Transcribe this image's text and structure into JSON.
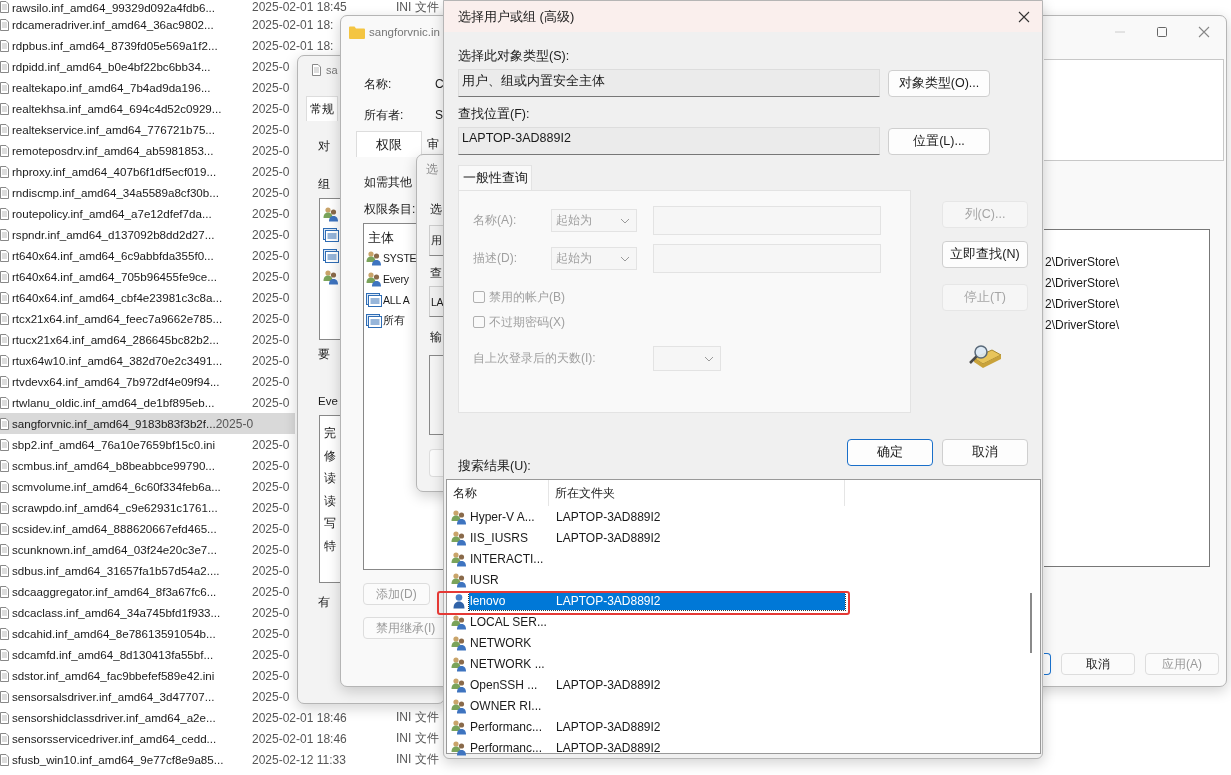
{
  "file_list": {
    "rows": [
      {
        "name": "rawsilo.inf_amd64_99329d092a4fdb6...",
        "date": "2025-02-01 18:45",
        "type": "INI 文件",
        "selected": false
      },
      {
        "name": "rdcameradriver.inf_amd64_36ac9802...",
        "date": "2025-02-01 18:",
        "selected": false
      },
      {
        "name": "rdpbus.inf_amd64_8739fd05e569a1f2...",
        "date": "2025-02-01 18:",
        "selected": false
      },
      {
        "name": "rdpidd.inf_amd64_b0e4bf22bc6bb34...",
        "date": "2025-0",
        "selected": false
      },
      {
        "name": "realtekapo.inf_amd64_7b4ad9da196...",
        "date": "2025-0",
        "selected": false
      },
      {
        "name": "realtekhsa.inf_amd64_694c4d52c0929...",
        "date": "2025-0",
        "selected": false
      },
      {
        "name": "realtekservice.inf_amd64_776721b75...",
        "date": "2025-0",
        "selected": false
      },
      {
        "name": "remoteposdrv.inf_amd64_ab5981853...",
        "date": "2025-0",
        "selected": false
      },
      {
        "name": "rhproxy.inf_amd64_407b6f1df5ecf019...",
        "date": "2025-0",
        "selected": false
      },
      {
        "name": "rndiscmp.inf_amd64_34a5589a8cf30b...",
        "date": "2025-0",
        "selected": false
      },
      {
        "name": "routepolicy.inf_amd64_a7e12dfef7da...",
        "date": "2025-0",
        "selected": false
      },
      {
        "name": "rspndr.inf_amd64_d137092b8dd2d27...",
        "date": "2025-0",
        "selected": false
      },
      {
        "name": "rt640x64.inf_amd64_6c9abbfda355f0...",
        "date": "2025-0",
        "selected": false
      },
      {
        "name": "rt640x64.inf_amd64_705b96455fe9ce...",
        "date": "2025-0",
        "selected": false
      },
      {
        "name": "rt640x64.inf_amd64_cbf4e23981c3c8a...",
        "date": "2025-0",
        "selected": false
      },
      {
        "name": "rtcx21x64.inf_amd64_feec7a9662e785...",
        "date": "2025-0",
        "selected": false
      },
      {
        "name": "rtucx21x64.inf_amd64_286645bc82b2...",
        "date": "2025-0",
        "selected": false
      },
      {
        "name": "rtux64w10.inf_amd64_382d70e2c3491...",
        "date": "2025-0",
        "selected": false
      },
      {
        "name": "rtvdevx64.inf_amd64_7b972df4e09f94...",
        "date": "2025-0",
        "selected": false
      },
      {
        "name": "rtwlanu_oldic.inf_amd64_de1bf895eb...",
        "date": "2025-0",
        "selected": false
      },
      {
        "name": "sangforvnic.inf_amd64_9183b83f3b2f...",
        "date": "2025-0",
        "selected": true
      },
      {
        "name": "sbp2.inf_amd64_76a10e7659bf15c0.ini",
        "date": "2025-0",
        "selected": false
      },
      {
        "name": "scmbus.inf_amd64_b8beabbce99790...",
        "date": "2025-0",
        "selected": false
      },
      {
        "name": "scmvolume.inf_amd64_6c60f334feb6a...",
        "date": "2025-0",
        "selected": false
      },
      {
        "name": "scrawpdo.inf_amd64_c9e62931c1761...",
        "date": "2025-0",
        "selected": false
      },
      {
        "name": "scsidev.inf_amd64_888620667efd465...",
        "date": "2025-0",
        "selected": false
      },
      {
        "name": "scunknown.inf_amd64_03f24e20c3e7...",
        "date": "2025-0",
        "selected": false
      },
      {
        "name": "sdbus.inf_amd64_31657fa1b57d54a2....",
        "date": "2025-0",
        "selected": false
      },
      {
        "name": "sdcaaggregator.inf_amd64_8f3a67fc6...",
        "date": "2025-0",
        "selected": false
      },
      {
        "name": "sdcaclass.inf_amd64_34a745bfd1f933...",
        "date": "2025-0",
        "selected": false
      },
      {
        "name": "sdcahid.inf_amd64_8e78613591054b...",
        "date": "2025-0",
        "selected": false
      },
      {
        "name": "sdcamfd.inf_amd64_8d130413fa55bf...",
        "date": "2025-0",
        "selected": false
      },
      {
        "name": "sdstor.inf_amd64_fac9bbefef589e42.ini",
        "date": "2025-0",
        "selected": false
      },
      {
        "name": "sensorsalsdriver.inf_amd64_3d47707...",
        "date": "2025-0",
        "selected": false
      },
      {
        "name": "sensorshidclassdriver.inf_amd64_a2e...",
        "date": "2025-02-01 18:46",
        "type": "INI 文件",
        "selected": false
      },
      {
        "name": "sensorsservicedriver.inf_amd64_cedd...",
        "date": "2025-02-01 18:46",
        "type": "INI 文件",
        "selected": false
      },
      {
        "name": "sfusb_win10.inf_amd64_9e77cf8e9a85...",
        "date": "2025-02-12 11:33",
        "type": "INI 文件",
        "selected": false
      }
    ]
  },
  "back_properties": {
    "title": "sa",
    "tab": "常规",
    "labels": [
      "对",
      "组"
    ],
    "entries": [
      {
        "kind": "users"
      },
      {
        "kind": "package"
      },
      {
        "kind": "package"
      },
      {
        "kind": "users"
      }
    ],
    "label_3": "要",
    "label_4": "Eve",
    "permissions": [
      "完",
      "修",
      "读",
      "读",
      "写",
      "特"
    ],
    "label_5": "有"
  },
  "properties": {
    "title": "sangforvnic.in",
    "name_label": "名称:",
    "name_value": "C",
    "owner_label": "所有者:",
    "owner_value": "S",
    "tabs": [
      {
        "label": "权限",
        "selected": true
      },
      {
        "label": "审",
        "selected": false
      }
    ],
    "hint": "如需其他",
    "entries_label": "权限条目:",
    "entries_header": "主体",
    "entries": [
      {
        "kind": "users",
        "name": "SYSTE"
      },
      {
        "kind": "users",
        "name": "Every"
      },
      {
        "kind": "package",
        "name": "ALL A"
      },
      {
        "kind": "package",
        "name": "所有"
      }
    ],
    "buttons": [
      {
        "label": "添加(D)",
        "disabled": true
      },
      {
        "label": "禁用继承(I)",
        "disabled": true
      }
    ],
    "paths": [
      "2\\DriverStore\\",
      "2\\DriverStore\\",
      "2\\DriverStore\\",
      "2\\DriverStore\\"
    ],
    "bottom_buttons": [
      {
        "label": "取消",
        "disabled": false
      },
      {
        "label": "应用(A)",
        "disabled": true
      }
    ]
  },
  "middle_dialog": {
    "title": "选",
    "label_1": "选",
    "field_1": "用",
    "label_2": "查",
    "field_2": "LA",
    "label_3": "输"
  },
  "search_dialog": {
    "title": "选择用户或组 (高级)",
    "object_type_label": "选择此对象类型(S):",
    "object_type_value": "用户、组或内置安全主体",
    "object_type_button": "对象类型(O)...",
    "location_label": "查找位置(F):",
    "location_value": "LAPTOP-3AD889I2",
    "location_button": "位置(L)...",
    "query_tab": "一般性查询",
    "query": {
      "name_label": "名称(A):",
      "name_mode": "起始为",
      "desc_label": "描述(D):",
      "desc_mode": "起始为",
      "checkboxes": [
        {
          "label": "禁用的帐户(B)",
          "checked": false,
          "disabled": true
        },
        {
          "label": "不过期密码(X)",
          "checked": false,
          "disabled": true
        }
      ],
      "days_label": "自上次登录后的天数(I):"
    },
    "side_buttons": [
      {
        "label": "列(C)...",
        "disabled": true
      },
      {
        "label": "立即查找(N)",
        "disabled": false
      },
      {
        "label": "停止(T)",
        "disabled": true
      }
    ],
    "buttons": [
      {
        "label": "确定",
        "default": true
      },
      {
        "label": "取消",
        "default": false
      }
    ],
    "results_label": "搜索结果(U):",
    "columns": [
      "名称",
      "所在文件夹"
    ],
    "rows": [
      {
        "kind": "group",
        "name": "Hyper-V A...",
        "folder": "LAPTOP-3AD889I2",
        "selected": false,
        "annotated": false
      },
      {
        "kind": "group",
        "name": "IIS_IUSRS",
        "folder": "LAPTOP-3AD889I2",
        "selected": false,
        "annotated": false
      },
      {
        "kind": "group",
        "name": "INTERACTI...",
        "selected": false,
        "annotated": false
      },
      {
        "kind": "group",
        "name": "IUSR",
        "selected": false,
        "annotated": false
      },
      {
        "kind": "user",
        "name": "lenovo",
        "folder": "LAPTOP-3AD889I2",
        "selected": true,
        "annotated": true
      },
      {
        "kind": "group",
        "name": "LOCAL SER...",
        "selected": false,
        "annotated": false
      },
      {
        "kind": "group",
        "name": "NETWORK",
        "selected": false,
        "annotated": false
      },
      {
        "kind": "group",
        "name": "NETWORK ...",
        "selected": false,
        "annotated": false
      },
      {
        "kind": "group",
        "name": "OpenSSH ...",
        "folder": "LAPTOP-3AD889I2",
        "selected": false,
        "annotated": false
      },
      {
        "kind": "group",
        "name": "OWNER RI...",
        "selected": false,
        "annotated": false
      },
      {
        "kind": "group",
        "name": "Performanc...",
        "folder": "LAPTOP-3AD889I2",
        "selected": false,
        "annotated": false
      },
      {
        "kind": "group",
        "name": "Performanc...",
        "folder": "LAPTOP-3AD889I2",
        "selected": false,
        "annotated": false
      }
    ]
  }
}
